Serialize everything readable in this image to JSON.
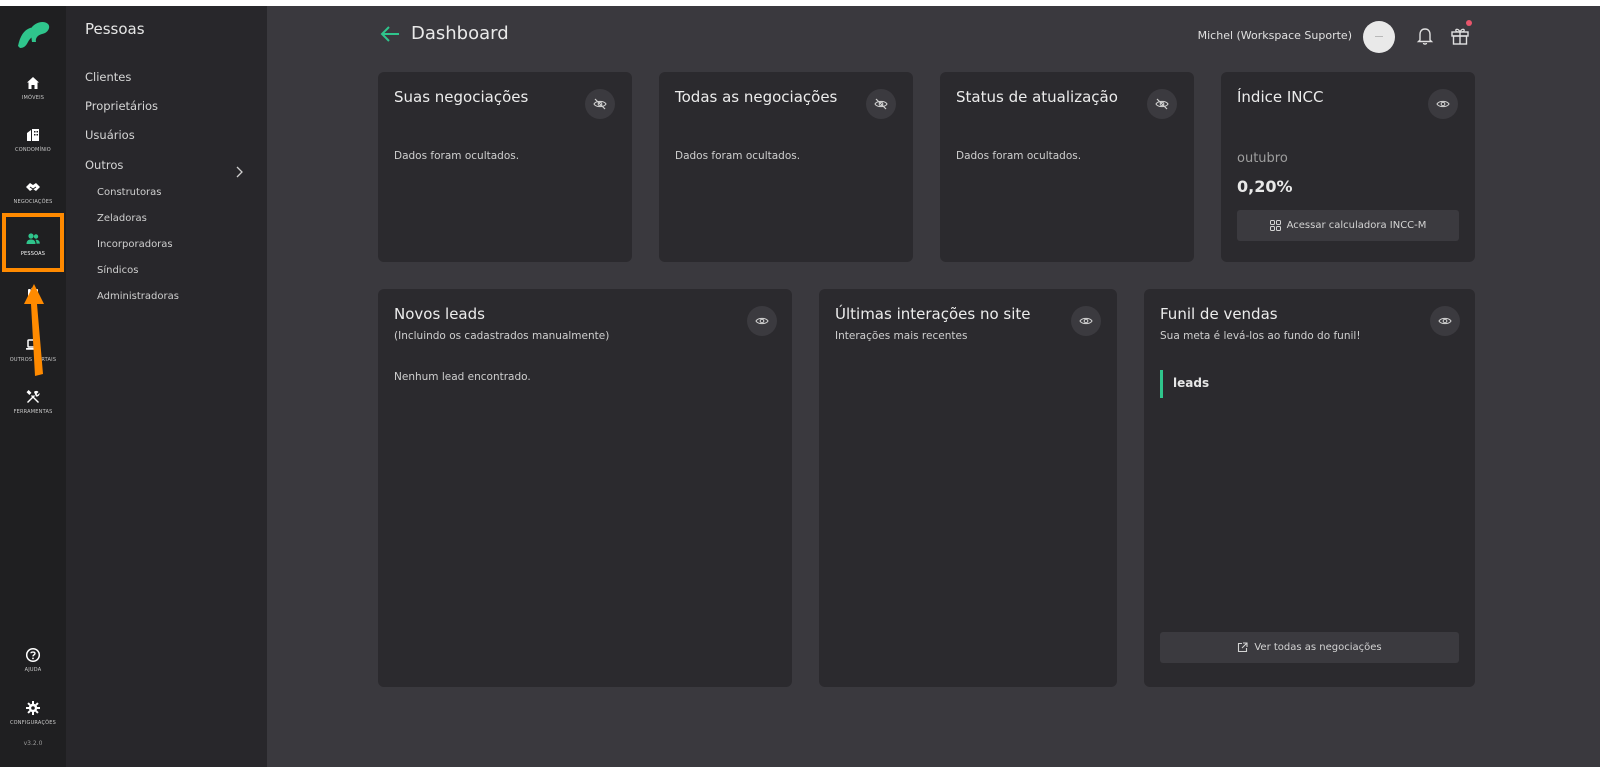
{
  "app": {
    "brand_color": "#2fc58c",
    "highlight_color": "#ff8a00",
    "version": "v3.2.0"
  },
  "rail": {
    "items": [
      {
        "label": "IMÓVEIS",
        "icon": "home-icon"
      },
      {
        "label": "CONDOMÍNIO",
        "icon": "building-icon"
      },
      {
        "label": "NEGOCIAÇÕES",
        "icon": "handshake-icon"
      },
      {
        "label": "PESSOAS",
        "icon": "people-icon",
        "active": true
      },
      {
        "label": "",
        "icon": "clipboard-icon"
      },
      {
        "label": "OUTROS PORTAIS",
        "icon": "laptop-icon"
      },
      {
        "label": "FERRAMENTAS",
        "icon": "tools-icon"
      }
    ],
    "bottom": [
      {
        "label": "AJUDA",
        "icon": "help-icon"
      },
      {
        "label": "CONFIGURAÇÕES",
        "icon": "gear-icon"
      }
    ]
  },
  "submenu": {
    "title": "Pessoas",
    "items": [
      "Clientes",
      "Proprietários",
      "Usuários",
      "Outros"
    ],
    "sub_items": [
      "Construtoras",
      "Zeladoras",
      "Incorporadoras",
      "Síndicos",
      "Administradoras"
    ]
  },
  "header": {
    "title": "Dashboard",
    "user": "Michel (Workspace Suporte)"
  },
  "cards": {
    "suas": {
      "title": "Suas negociações",
      "message": "Dados foram ocultados."
    },
    "todas": {
      "title": "Todas as negociações",
      "message": "Dados foram ocultados."
    },
    "status": {
      "title": "Status de atualização",
      "message": "Dados foram ocultados."
    },
    "incc": {
      "title": "Índice INCC",
      "month": "outubro",
      "value": "0,20%",
      "button": "Acessar calculadora INCC-M"
    },
    "leads": {
      "title": "Novos leads",
      "subtitle": "(Incluindo os cadastrados manualmente)",
      "empty": "Nenhum lead encontrado."
    },
    "interacoes": {
      "title": "Últimas interações no site",
      "subtitle": "Interações mais recentes"
    },
    "funil": {
      "title": "Funil de vendas",
      "subtitle": "Sua meta é levá-los ao fundo do funil!",
      "stage": "leads",
      "button": "Ver todas as negociações"
    }
  }
}
